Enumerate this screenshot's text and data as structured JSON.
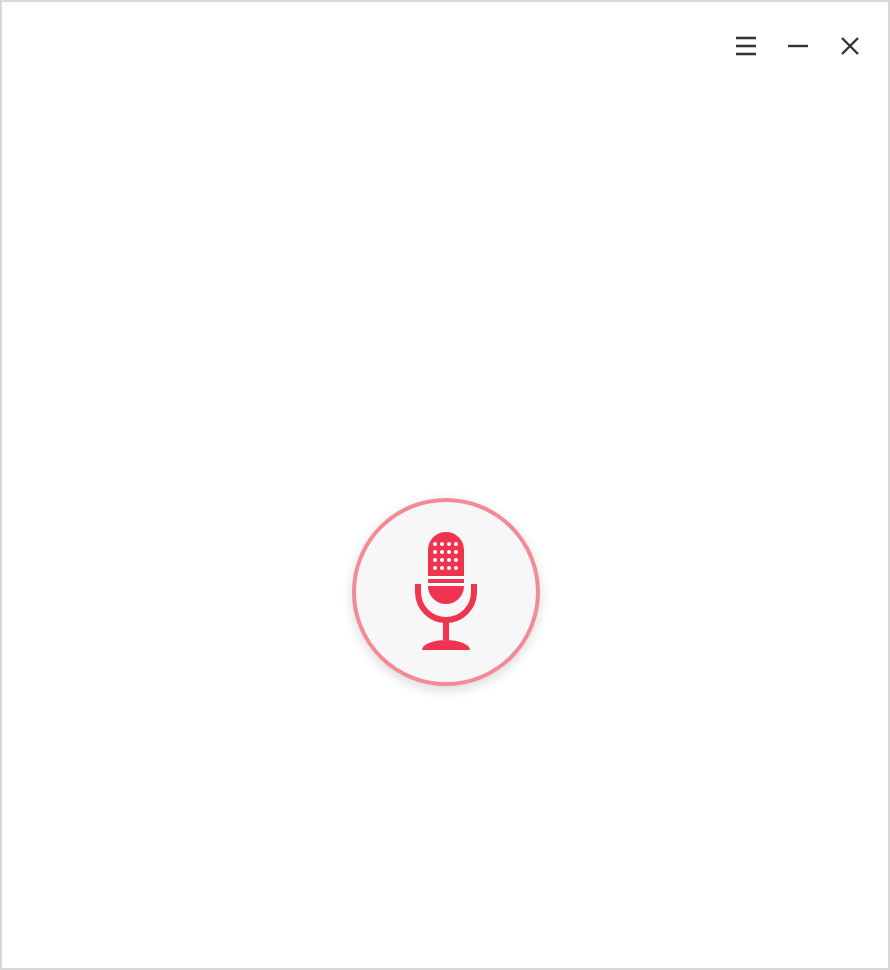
{
  "window": {
    "controls": [
      {
        "kind": "menu"
      },
      {
        "kind": "minimize"
      },
      {
        "kind": "close"
      }
    ]
  },
  "record_button": {
    "kind": "microphone"
  }
}
